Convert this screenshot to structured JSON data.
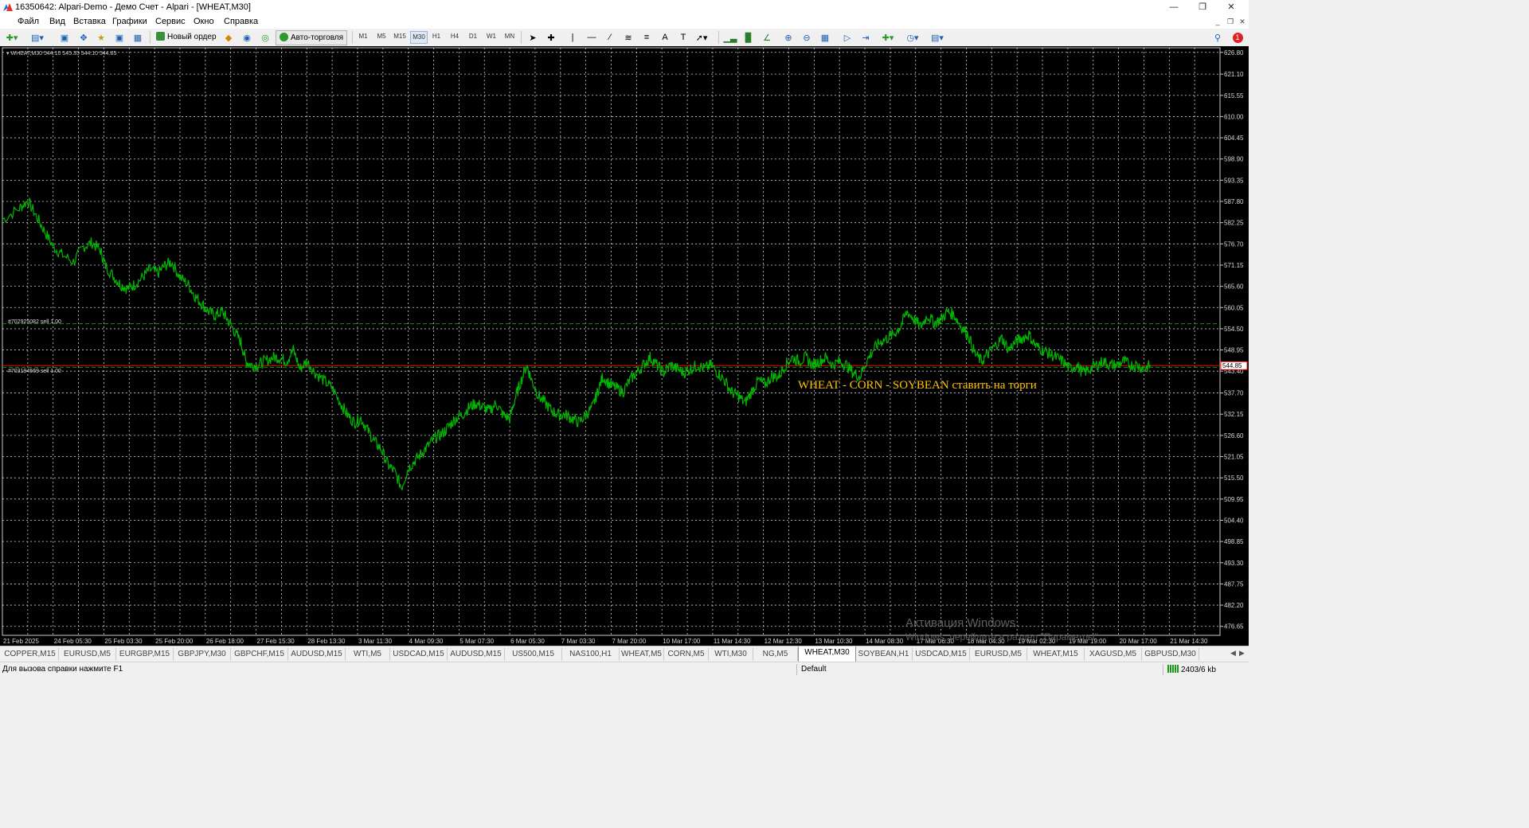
{
  "window": {
    "title": "16350642: Alpari-Demo - Демо Счет - Alpari - [WHEAT,M30]"
  },
  "menu": [
    "Файл",
    "Вид",
    "Вставка",
    "Графики",
    "Сервис",
    "Окно",
    "Справка"
  ],
  "toolbar": {
    "new_order_label": "Новый ордер",
    "autotrading_label": "Авто-торговля",
    "timeframes": [
      "M1",
      "M5",
      "M15",
      "M30",
      "H1",
      "H4",
      "D1",
      "W1",
      "MN"
    ],
    "active_timeframe": "M30",
    "notification_count": "1"
  },
  "chart": {
    "symbol_info": "WHEAT,M30  544.10 545.35 544.10 544.85",
    "current_price": "544.85",
    "orders": [
      {
        "label": "#702925082 sell 1.00",
        "price": 555.8
      },
      {
        "label": "#703194569 sell 1.00",
        "price": 544.4
      }
    ],
    "annotation": "WHEAT - CORN - SOYBEAN ставить на торги",
    "annotation_color": "#ffc400",
    "background": "#000000",
    "candle_color": "#00b400",
    "bid_line_color": "#ff0000",
    "order_line_color": "#00a000",
    "watermark": {
      "line1": "Активация Windows",
      "line2": "Windows, перейдите в раздел \"Параметры\"."
    }
  },
  "chart_data": {
    "type": "line",
    "title": "WHEAT,M30",
    "ylim": [
      474.3,
      628.0
    ],
    "y_ticks": [
      "626.80",
      "621.10",
      "615.55",
      "610.00",
      "604.45",
      "598.90",
      "593.35",
      "587.80",
      "582.25",
      "576.70",
      "571.15",
      "565.60",
      "560.05",
      "554.50",
      "548.95",
      "543.40",
      "537.70",
      "532.15",
      "526.60",
      "521.05",
      "515.50",
      "509.95",
      "504.40",
      "498.85",
      "493.30",
      "487.75",
      "482.20",
      "476.65"
    ],
    "x_ticks": [
      "21 Feb 2025",
      "24 Feb 05:30",
      "25 Feb 03:30",
      "25 Feb 20:00",
      "26 Feb 18:00",
      "27 Feb 15:30",
      "28 Feb 13:30",
      "3 Mar 11:30",
      "4 Mar 09:30",
      "5 Mar 07:30",
      "6 Mar 05:30",
      "7 Mar 03:30",
      "7 Mar 20:00",
      "10 Mar 17:00",
      "11 Mar 14:30",
      "12 Mar 12:30",
      "13 Mar 10:30",
      "14 Mar 08:30",
      "17 Mar 06:30",
      "18 Mar 04:30",
      "19 Mar 02:30",
      "19 Mar 19:00",
      "20 Mar 17:00",
      "21 Mar 14:30"
    ],
    "series": [
      {
        "name": "WHEAT,M30",
        "values": [
          [
            0,
            583
          ],
          [
            1,
            586
          ],
          [
            1.5,
            588
          ],
          [
            2,
            584
          ],
          [
            2.5,
            580
          ],
          [
            3,
            576
          ],
          [
            3.5,
            574
          ],
          [
            4.2,
            572
          ],
          [
            4.8,
            576
          ],
          [
            5.3,
            577
          ],
          [
            5.8,
            575
          ],
          [
            6.1,
            571
          ],
          [
            6.6,
            568
          ],
          [
            7,
            566
          ],
          [
            7.4,
            565
          ],
          [
            7.8,
            566
          ],
          [
            8.3,
            568
          ],
          [
            8.7,
            570
          ],
          [
            9.2,
            569
          ],
          [
            9.6,
            571
          ],
          [
            10,
            572
          ],
          [
            10.5,
            568
          ],
          [
            11,
            566
          ],
          [
            11.4,
            563
          ],
          [
            11.8,
            561
          ],
          [
            12.2,
            559
          ],
          [
            12.6,
            558
          ],
          [
            13,
            559
          ],
          [
            13.3,
            557
          ],
          [
            13.7,
            554
          ],
          [
            14.1,
            551
          ],
          [
            14.4,
            546
          ],
          [
            14.7,
            545
          ],
          [
            15.1,
            545
          ],
          [
            15.5,
            546
          ],
          [
            16,
            547
          ],
          [
            16.4,
            547
          ],
          [
            16.8,
            546
          ],
          [
            17.2,
            549
          ],
          [
            17.6,
            544
          ],
          [
            18,
            546
          ],
          [
            18.5,
            543
          ],
          [
            19,
            541
          ],
          [
            19.5,
            539
          ],
          [
            20,
            535
          ],
          [
            20.4,
            532
          ],
          [
            20.8,
            530
          ],
          [
            21.2,
            531
          ],
          [
            21.6,
            528
          ],
          [
            22,
            525
          ],
          [
            22.4,
            523
          ],
          [
            22.8,
            519
          ],
          [
            23.2,
            517
          ],
          [
            23.6,
            513
          ],
          [
            24,
            518
          ],
          [
            24.4,
            520
          ],
          [
            24.8,
            522
          ],
          [
            25.2,
            524
          ],
          [
            25.6,
            526
          ],
          [
            26,
            527
          ],
          [
            26.4,
            529
          ],
          [
            26.8,
            531
          ],
          [
            27.2,
            532
          ],
          [
            27.6,
            534
          ],
          [
            28,
            535
          ],
          [
            28.4,
            534
          ],
          [
            28.8,
            533
          ],
          [
            29.2,
            535
          ],
          [
            29.6,
            532
          ],
          [
            30,
            531
          ],
          [
            30.3,
            536
          ],
          [
            30.6,
            540
          ],
          [
            31,
            545
          ],
          [
            31.3,
            541
          ],
          [
            31.7,
            537
          ],
          [
            32.1,
            535
          ],
          [
            32.5,
            533
          ],
          [
            32.9,
            532
          ],
          [
            33.3,
            532
          ],
          [
            33.7,
            531
          ],
          [
            34.1,
            530
          ],
          [
            34.5,
            532
          ],
          [
            34.9,
            534
          ],
          [
            35.2,
            538
          ],
          [
            35.5,
            542
          ],
          [
            35.9,
            540
          ],
          [
            36.3,
            539
          ],
          [
            36.7,
            538
          ],
          [
            37.1,
            541
          ],
          [
            37.5,
            543
          ],
          [
            37.9,
            545
          ],
          [
            38.3,
            547
          ],
          [
            38.7,
            545
          ],
          [
            39.1,
            543
          ],
          [
            39.5,
            545
          ],
          [
            39.9,
            544
          ],
          [
            40.3,
            543
          ],
          [
            40.7,
            544
          ],
          [
            41.1,
            545
          ],
          [
            41.5,
            544
          ],
          [
            41.9,
            545
          ],
          [
            42.3,
            543
          ],
          [
            42.7,
            541
          ],
          [
            43.1,
            538
          ],
          [
            43.5,
            537
          ],
          [
            43.9,
            535
          ],
          [
            44.3,
            538
          ],
          [
            44.7,
            541
          ],
          [
            45.1,
            540
          ],
          [
            45.5,
            542
          ],
          [
            45.9,
            542
          ],
          [
            46.3,
            545
          ],
          [
            46.7,
            547
          ],
          [
            47.1,
            546
          ],
          [
            47.5,
            547
          ],
          [
            47.9,
            545
          ],
          [
            48.3,
            546
          ],
          [
            48.7,
            547
          ],
          [
            49.1,
            545
          ],
          [
            49.5,
            546
          ],
          [
            49.9,
            545
          ],
          [
            50.3,
            543
          ],
          [
            50.7,
            542
          ],
          [
            51.1,
            546
          ],
          [
            51.5,
            549
          ],
          [
            51.9,
            551
          ],
          [
            52.3,
            552
          ],
          [
            52.7,
            553
          ],
          [
            53.1,
            555
          ],
          [
            53.5,
            559
          ],
          [
            53.9,
            557
          ],
          [
            54.3,
            555
          ],
          [
            54.7,
            558
          ],
          [
            55.1,
            556
          ],
          [
            55.5,
            557
          ],
          [
            55.9,
            559
          ],
          [
            56.3,
            558
          ],
          [
            56.7,
            555
          ],
          [
            57.1,
            553
          ],
          [
            57.5,
            548
          ],
          [
            57.9,
            546
          ],
          [
            58.3,
            548
          ],
          [
            58.7,
            550
          ],
          [
            59.1,
            552
          ],
          [
            59.5,
            549
          ],
          [
            59.9,
            551
          ],
          [
            60.3,
            552
          ],
          [
            60.7,
            553
          ],
          [
            61.1,
            550
          ],
          [
            61.5,
            549
          ],
          [
            61.9,
            548
          ],
          [
            62.3,
            547
          ],
          [
            62.7,
            546
          ],
          [
            63.1,
            544
          ],
          [
            63.5,
            545
          ],
          [
            63.9,
            543
          ],
          [
            64.3,
            544
          ],
          [
            64.7,
            545
          ],
          [
            65.1,
            546
          ],
          [
            65.5,
            545
          ],
          [
            65.9,
            545
          ],
          [
            66.3,
            546
          ],
          [
            66.7,
            545
          ],
          [
            67.1,
            545
          ],
          [
            67.5,
            544
          ],
          [
            67.9,
            545
          ]
        ]
      }
    ]
  },
  "tabs": {
    "items": [
      "COPPER,M15",
      "EURUSD,M5",
      "EURGBP,M15",
      "GBPJPY,M30",
      "GBPCHF,M15",
      "AUDUSD,M15",
      "WTI,M5",
      "USDCAD,M15",
      "AUDUSD,M15",
      "US500,M15",
      "NAS100,H1",
      "WHEAT,M5",
      "CORN,M5",
      "WTI,M30",
      "NG,M5",
      "WHEAT,M30",
      "SOYBEAN,H1",
      "USDCAD,M15",
      "EURUSD,M5",
      "WHEAT,M15",
      "XAGUSD,M5",
      "GBPUSD,M30"
    ],
    "active": "WHEAT,M30"
  },
  "status": {
    "help": "Для вызова справки нажмите F1",
    "profile": "Default",
    "connection": "2403/6 kb"
  }
}
